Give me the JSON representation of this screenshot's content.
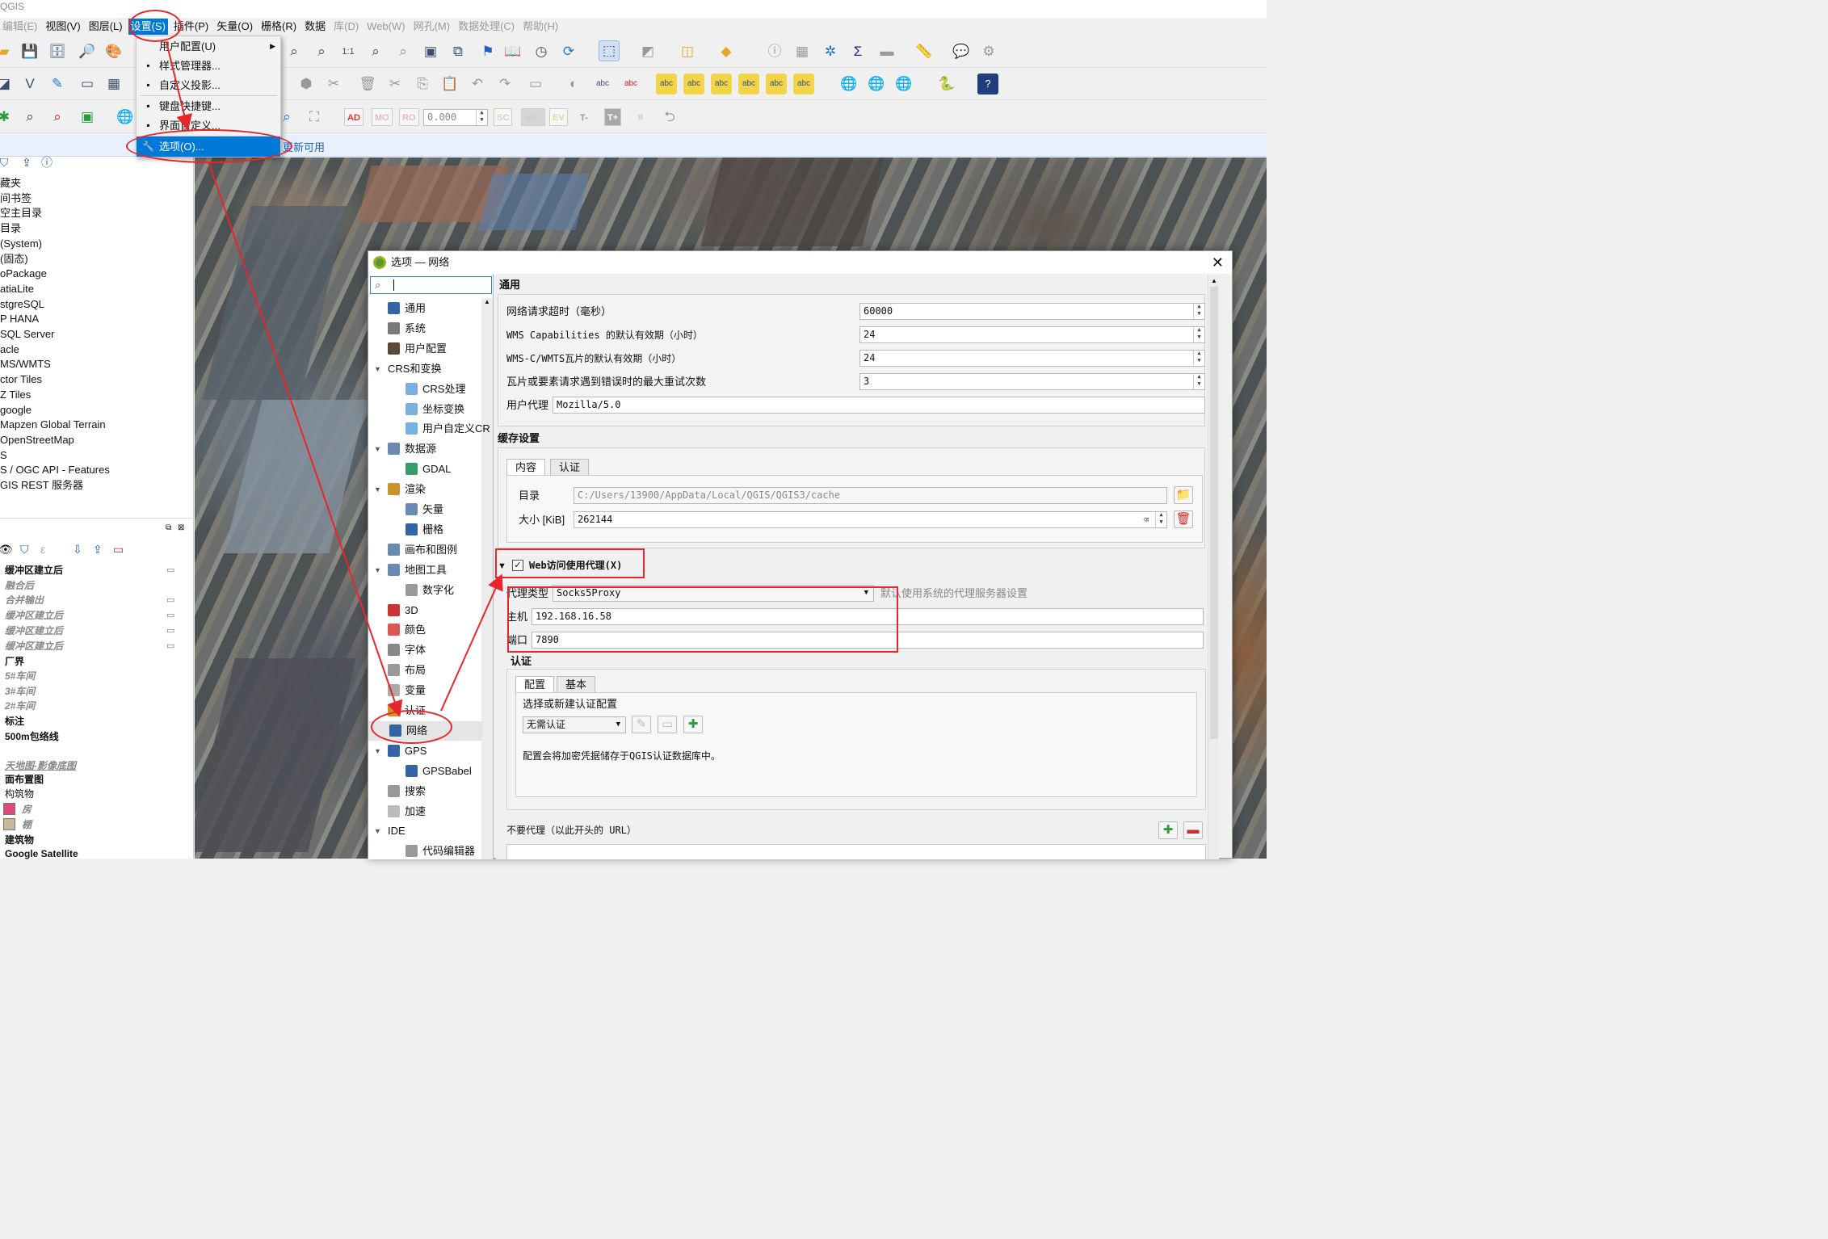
{
  "app": {
    "title": "QGIS"
  },
  "menubar": {
    "items": [
      {
        "label": "编辑(E)",
        "state": "gray"
      },
      {
        "label": "视图(V)",
        "state": "normal"
      },
      {
        "label": "图层(L)",
        "state": "normal"
      },
      {
        "label": "设置(S)",
        "state": "active"
      },
      {
        "label": "插件(P)",
        "state": "normal"
      },
      {
        "label": "矢量(O)",
        "state": "normal"
      },
      {
        "label": "栅格(R)",
        "state": "normal"
      },
      {
        "label": "数据",
        "state": "normal"
      },
      {
        "label": "库(D)",
        "state": "gray"
      },
      {
        "label": "Web(W)",
        "state": "gray"
      },
      {
        "label": "网孔(M)",
        "state": "gray"
      },
      {
        "label": "数据处理(C)",
        "state": "gray"
      },
      {
        "label": "帮助(H)",
        "state": "gray"
      }
    ]
  },
  "settings_menu": {
    "items": [
      {
        "label": "用户配置(U)",
        "icon": "user-profile-icon"
      },
      {
        "label": "样式管理器...",
        "icon": "style-manager-icon"
      },
      {
        "label": "自定义投影...",
        "icon": "projection-icon"
      },
      {
        "label": "键盘快捷键...",
        "icon": "keyboard-icon"
      },
      {
        "label": "界面自定义...",
        "icon": "interface-icon"
      },
      {
        "label": "选项(O)...",
        "icon": "wrench-icon"
      }
    ]
  },
  "toolbar": {
    "zoom_value": "0.000",
    "snap_tags": [
      "AD",
      "MO",
      "RO"
    ],
    "snap_tags2": [
      "SC",
      "ADJ",
      "EV",
      "T-",
      "T+"
    ]
  },
  "message_bar": {
    "text": "更新可用"
  },
  "browser": {
    "items": [
      "藏夹",
      "间书签",
      "空主目录",
      "目录",
      "(System)",
      "(固态)",
      "oPackage",
      "atiaLite",
      "stgreSQL",
      "P HANA",
      " SQL Server",
      "acle",
      "MS/WMTS",
      "ctor Tiles",
      "Z Tiles",
      "google",
      "Mapzen Global Terrain",
      "OpenStreetMap",
      "S",
      "S / OGC API - Features",
      "GIS REST 服务器"
    ]
  },
  "layers": {
    "items": [
      {
        "label": "缓冲区建立后",
        "style": "bold"
      },
      {
        "label": "融合后",
        "style": "ital"
      },
      {
        "label": "合并输出",
        "style": "ital"
      },
      {
        "label": "缓冲区建立后",
        "style": "ital"
      },
      {
        "label": "缓冲区建立后",
        "style": "ital"
      },
      {
        "label": "缓冲区建立后",
        "style": "ital"
      },
      {
        "label": "厂界",
        "style": "bold"
      },
      {
        "label": "5#车间",
        "style": "ital"
      },
      {
        "label": "3#车间",
        "style": "ital"
      },
      {
        "label": "2#车间",
        "style": "ital"
      },
      {
        "label": "标注",
        "style": "bold"
      },
      {
        "label": "500m包络线",
        "style": "bold"
      },
      {
        "label": "天地图-影像底图",
        "style": "ital"
      },
      {
        "label": "面布置图",
        "style": "bold"
      },
      {
        "label": "构筑物",
        "style": "normal"
      },
      {
        "label": "房",
        "style": "ital"
      },
      {
        "label": "棚",
        "style": "ital"
      },
      {
        "label": "建筑物",
        "style": "bold"
      },
      {
        "label": "Google Satellite",
        "style": "bold"
      }
    ],
    "swatch_colors": {
      "房": "#e04a7a",
      "棚": "#c8b89a"
    }
  },
  "dialog": {
    "title": "选项 — 网络",
    "search": {
      "value": "",
      "placeholder": ""
    },
    "sidebar": [
      {
        "label": "通用",
        "indent": 0,
        "icon": "wrench-icon"
      },
      {
        "label": "系统",
        "indent": 0,
        "icon": "gear-icon"
      },
      {
        "label": "用户配置",
        "indent": 0,
        "icon": "user-icon"
      },
      {
        "label": "CRS和变换",
        "indent": 0,
        "icon": "",
        "expanded": true
      },
      {
        "label": "CRS处理",
        "indent": 1,
        "icon": "globe-icon"
      },
      {
        "label": "坐标变换",
        "indent": 1,
        "icon": "globe-icon"
      },
      {
        "label": "用户自定义CR",
        "indent": 1,
        "icon": "globe-icon"
      },
      {
        "label": "数据源",
        "indent": 0,
        "icon": "table-icon",
        "expanded": true
      },
      {
        "label": "GDAL",
        "indent": 1,
        "icon": "gdal-icon"
      },
      {
        "label": "渲染",
        "indent": 0,
        "icon": "brush-icon",
        "expanded": true
      },
      {
        "label": "矢量",
        "indent": 1,
        "icon": "vector-icon"
      },
      {
        "label": "栅格",
        "indent": 1,
        "icon": "raster-icon"
      },
      {
        "label": "画布和图例",
        "indent": 0,
        "icon": "canvas-icon"
      },
      {
        "label": "地图工具",
        "indent": 0,
        "icon": "map-tools-icon",
        "expanded": true
      },
      {
        "label": "数字化",
        "indent": 1,
        "icon": "digitize-icon"
      },
      {
        "label": "3D",
        "indent": 0,
        "icon": "cube-icon"
      },
      {
        "label": "颜色",
        "indent": 0,
        "icon": "color-icon"
      },
      {
        "label": "字体",
        "indent": 0,
        "icon": "font-icon"
      },
      {
        "label": "布局",
        "indent": 0,
        "icon": "layout-icon"
      },
      {
        "label": "变量",
        "indent": 0,
        "icon": "variable-icon"
      },
      {
        "label": "认证",
        "indent": 0,
        "icon": "lock-icon"
      },
      {
        "label": "网络",
        "indent": 0,
        "icon": "network-icon",
        "selected": true
      },
      {
        "label": "GPS",
        "indent": 0,
        "icon": "gps-icon",
        "expanded": true
      },
      {
        "label": "GPSBabel",
        "indent": 1,
        "icon": "gps-icon"
      },
      {
        "label": "搜索",
        "indent": 0,
        "icon": "search-icon"
      },
      {
        "label": "加速",
        "indent": 0,
        "icon": "accel-icon"
      },
      {
        "label": "IDE",
        "indent": 0,
        "icon": "",
        "expanded": true
      },
      {
        "label": "代码编辑器",
        "indent": 1,
        "icon": "code-icon"
      }
    ],
    "general": {
      "title": "通用",
      "timeout_label": "网络请求超时（毫秒）",
      "timeout_value": "60000",
      "wms_label": "WMS Capabilities 的默认有效期（小时）",
      "wms_value": "24",
      "wmts_label": "WMS-C/WMTS瓦片的默认有效期（小时）",
      "wmts_value": "24",
      "retry_label": "瓦片或要素请求遇到错误时的最大重试次数",
      "retry_value": "3",
      "useragent_label": "用户代理",
      "useragent_value": "Mozilla/5.0"
    },
    "cache": {
      "title": "缓存设置",
      "tabs": [
        "内容",
        "认证"
      ],
      "dir_label": "目录",
      "dir_value": "C:/Users/13900/AppData/Local/QGIS/QGIS3/cache",
      "size_label": "大小 [KiB]",
      "size_value": "262144"
    },
    "proxy": {
      "checkbox_label": "Web访问使用代理(X)",
      "checked": true,
      "type_label": "代理类型",
      "type_value": "Socks5Proxy",
      "type_hint": "默认使用系统的代理服务器设置",
      "host_label": "主机",
      "host_value": "192.168.16.58",
      "port_label": "端口",
      "port_value": "7890"
    },
    "auth": {
      "title": "认证",
      "tabs": [
        "配置",
        "基本"
      ],
      "select_label": "选择或新建认证配置",
      "select_value": "无需认证",
      "note": "配置会将加密凭据储存于QGIS认证数据库中。"
    },
    "no_proxy": {
      "label": "不要代理（以此开头的 URL）"
    }
  },
  "colors": {
    "accent": "#0078d7",
    "annotation": "#e8262a",
    "delete": "#d62b2b"
  }
}
